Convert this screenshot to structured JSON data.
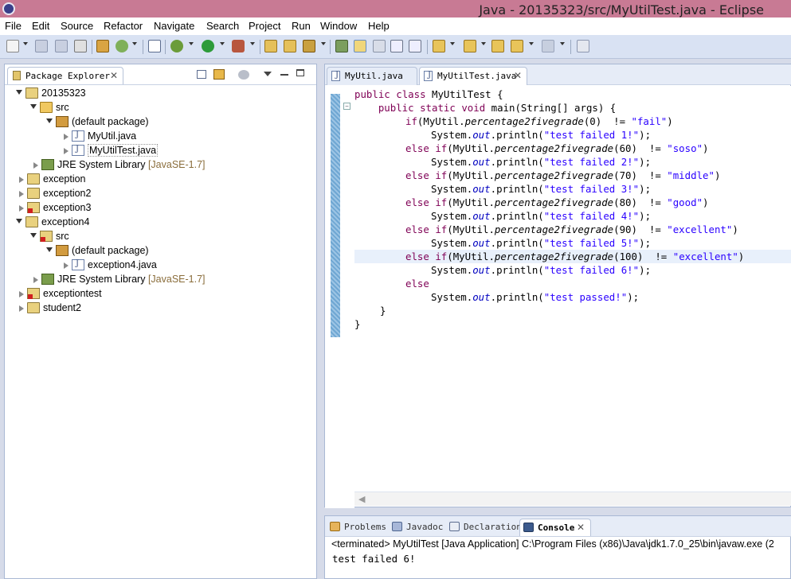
{
  "window": {
    "title": "Java - 20135323/src/MyUtilTest.java - Eclipse"
  },
  "menu": [
    "File",
    "Edit",
    "Source",
    "Refactor",
    "Navigate",
    "Search",
    "Project",
    "Run",
    "Window",
    "Help"
  ],
  "toolbar_icons": [
    "new-icon",
    "save-icon",
    "save-all-icon",
    "print-icon",
    "build-icon",
    "refresh-icon",
    "skip-breakpoints-icon",
    "debug-icon",
    "run-icon",
    "external-tools-icon",
    "new-java-project-icon",
    "new-package-icon",
    "new-class-icon",
    "open-type-icon",
    "mark-occurrences-icon",
    "search-icon",
    "toggle-block-selection-icon",
    "show-whitespace-icon",
    "next-annotation-icon",
    "previous-annotation-icon",
    "last-edit-icon",
    "back-icon",
    "forward-icon",
    "pin-editor-icon"
  ],
  "explorer": {
    "tab_label": "Package Explorer",
    "tree": [
      {
        "label": "20135323",
        "decoration": ""
      },
      {
        "label": "src",
        "decoration": ""
      },
      {
        "label": "(default package)",
        "decoration": ""
      },
      {
        "label": "MyUtil.java",
        "decoration": ""
      },
      {
        "label": "MyUtilTest.java",
        "decoration": ""
      },
      {
        "label": "JRE System Library",
        "decoration": "[JavaSE-1.7]"
      },
      {
        "label": "exception",
        "decoration": ""
      },
      {
        "label": "exception2",
        "decoration": ""
      },
      {
        "label": "exception3",
        "decoration": ""
      },
      {
        "label": "exception4",
        "decoration": ""
      },
      {
        "label": "src",
        "decoration": ""
      },
      {
        "label": "(default package)",
        "decoration": ""
      },
      {
        "label": "exception4.java",
        "decoration": ""
      },
      {
        "label": "JRE System Library",
        "decoration": "[JavaSE-1.7]"
      },
      {
        "label": "exceptiontest",
        "decoration": ""
      },
      {
        "label": "student2",
        "decoration": ""
      }
    ]
  },
  "editor": {
    "tabs": [
      {
        "label": "MyUtil.java",
        "active": false
      },
      {
        "label": "MyUtilTest.java",
        "active": true
      }
    ],
    "code": {
      "l1": {
        "a": "public",
        "b": " ",
        "c": "class",
        "d": " MyUtilTest {"
      },
      "l2": {
        "a": "    ",
        "b": "public",
        "c": " ",
        "d": "static",
        "e": " ",
        "f": "void",
        "g": " main(String[] args) {"
      },
      "l3": {
        "a": "if",
        "b": "(MyUtil.",
        "c": "percentage2fivegrade",
        "d": "(0)  != ",
        "e": "\"fail\"",
        "f": ")"
      },
      "l4": {
        "a": "System.",
        "b": "out",
        "c": ".println(",
        "d": "\"test failed 1!\"",
        "e": ");"
      },
      "l5": {
        "a": "else",
        "b": " ",
        "c": "if",
        "d": "(MyUtil.",
        "e": "percentage2fivegrade",
        "f": "(60)  != ",
        "g": "\"soso\"",
        "h": ")"
      },
      "l6": {
        "a": "System.",
        "b": "out",
        "c": ".println(",
        "d": "\"test failed 2!\"",
        "e": ");"
      },
      "l7": {
        "a": "else",
        "b": " ",
        "c": "if",
        "d": "(MyUtil.",
        "e": "percentage2fivegrade",
        "f": "(70)  != ",
        "g": "\"middle\"",
        "h": ")"
      },
      "l8": {
        "a": "System.",
        "b": "out",
        "c": ".println(",
        "d": "\"test failed 3!\"",
        "e": ");"
      },
      "l9": {
        "a": "else",
        "b": " ",
        "c": "if",
        "d": "(MyUtil.",
        "e": "percentage2fivegrade",
        "f": "(80)  != ",
        "g": "\"good\"",
        "h": ")"
      },
      "l10": {
        "a": "System.",
        "b": "out",
        "c": ".println(",
        "d": "\"test failed 4!\"",
        "e": ");"
      },
      "l11": {
        "a": "else",
        "b": " ",
        "c": "if",
        "d": "(MyUtil.",
        "e": "percentage2fivegrade",
        "f": "(90)  != ",
        "g": "\"excellent\"",
        "h": ")"
      },
      "l12": {
        "a": "System.",
        "b": "out",
        "c": ".println(",
        "d": "\"test failed 5!\"",
        "e": ");"
      },
      "l13": {
        "a": "else",
        "b": " ",
        "c": "if",
        "d": "(MyUtil.",
        "e": "percentage2fivegrade",
        "f": "(100)  != ",
        "g": "\"excellent\"",
        "h": ")"
      },
      "l14": {
        "a": "System.",
        "b": "out",
        "c": ".println(",
        "d": "\"test failed 6!\"",
        "e": ");"
      },
      "l15": {
        "a": "else"
      },
      "l16": {
        "a": "System.",
        "b": "out",
        "c": ".println(",
        "d": "\"test passed!\"",
        "e": ");"
      },
      "l17": {
        "a": "}"
      },
      "l18": {
        "a": "}"
      }
    }
  },
  "console": {
    "tabs": [
      "Problems",
      "Javadoc",
      "Declaration",
      "Console"
    ],
    "active_tab": "Console",
    "terminated_line": "<terminated> MyUtilTest [Java Application] C:\\Program Files (x86)\\Java\\jdk1.7.0_25\\bin\\javaw.exe (2",
    "output": "test failed 6!"
  },
  "colors": {
    "title_bar": "#c87a94",
    "keyword": "#7f0055",
    "string": "#2a00ff",
    "field": "#0000c0",
    "toolbar": "#d9e2f3"
  }
}
